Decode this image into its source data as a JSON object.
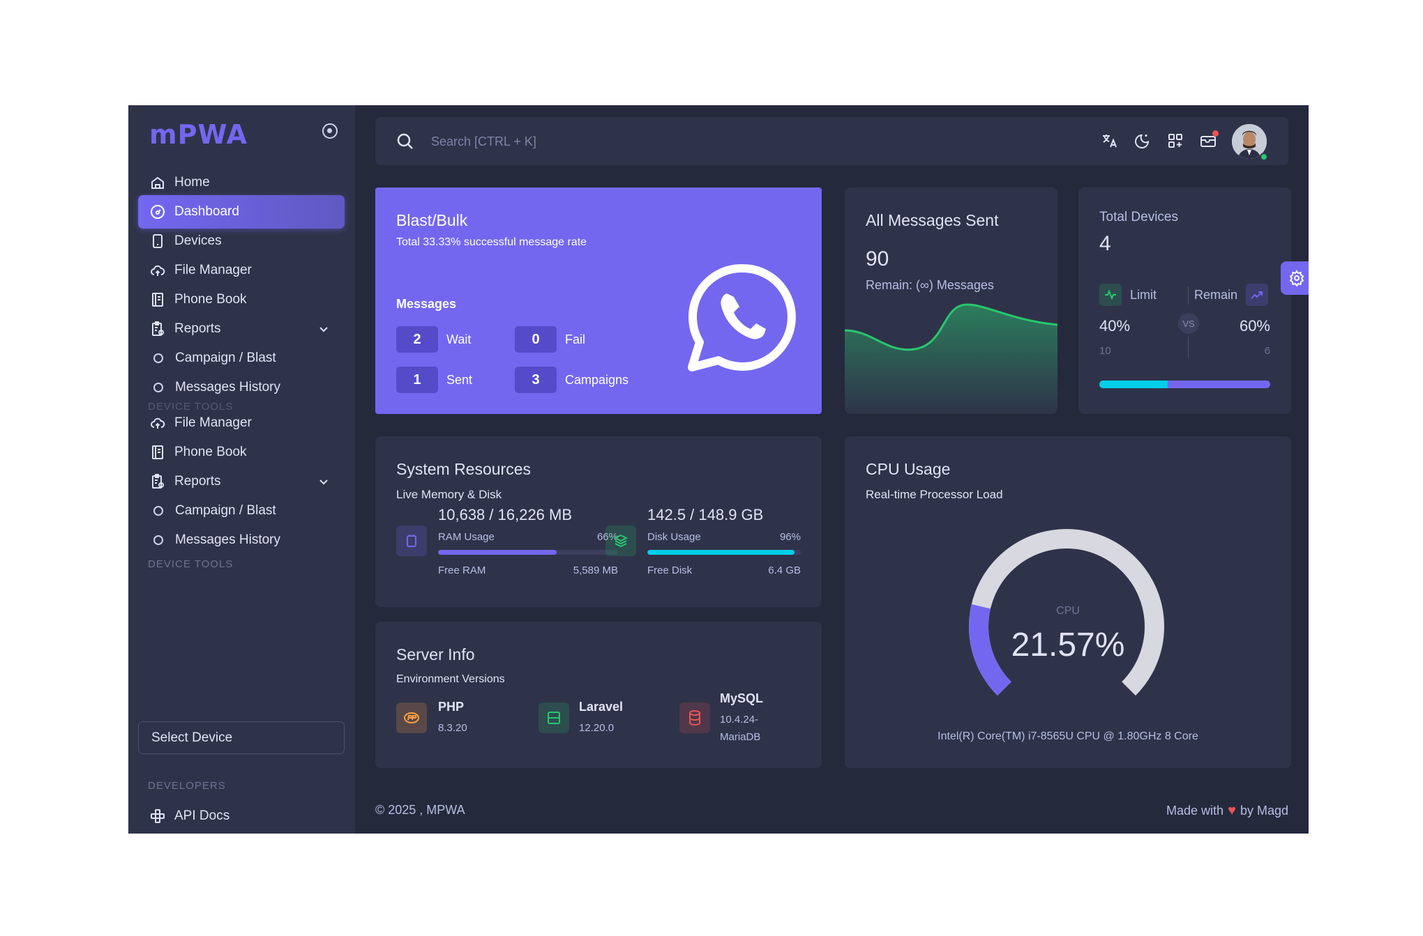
{
  "app": {
    "logo": "mPWA"
  },
  "colors": {
    "primary": "#7367f0",
    "info": "#00cfe8",
    "success": "#28c76f",
    "danger": "#ea5455",
    "bg": "#25293c",
    "card": "#2f3349"
  },
  "sidebar": {
    "items": [
      {
        "label": "Home",
        "icon": "home-icon"
      },
      {
        "label": "Dashboard",
        "icon": "dashboard-icon",
        "active": true
      },
      {
        "label": "Devices",
        "icon": "device-icon"
      },
      {
        "label": "File Manager",
        "icon": "cloud-upload-icon"
      },
      {
        "label": "Phone Book",
        "icon": "phonebook-icon"
      },
      {
        "label": "Reports",
        "icon": "report-icon"
      },
      {
        "label": "Campaign / Blast",
        "icon": "circle-icon"
      },
      {
        "label": "Messages History",
        "icon": "circle-icon"
      },
      {
        "label": "File Manager",
        "icon": "cloud-upload-icon"
      },
      {
        "label": "Phone Book",
        "icon": "phonebook-icon"
      },
      {
        "label": "Reports",
        "icon": "report-icon"
      },
      {
        "label": "Campaign / Blast",
        "icon": "circle-icon"
      },
      {
        "label": "Messages History",
        "icon": "circle-icon"
      },
      {
        "label": "API Docs",
        "icon": "api-icon"
      }
    ],
    "section_device_tools": "DEVICE TOOLS",
    "section_device_tools_ghost": "DEVICE TOOLS",
    "select_device": "Select Device",
    "section_developers": "DEVELOPERS"
  },
  "header": {
    "search_placeholder": "Search [CTRL + K]"
  },
  "blast": {
    "title": "Blast/Bulk",
    "subtitle": "Total 33.33% successful message rate",
    "messages_label": "Messages",
    "stats": [
      {
        "value": "2",
        "label": "Wait"
      },
      {
        "value": "0",
        "label": "Fail"
      },
      {
        "value": "1",
        "label": "Sent"
      },
      {
        "value": "3",
        "label": "Campaigns"
      }
    ]
  },
  "messages_sent": {
    "title": "All Messages Sent",
    "value": "90",
    "remain": "Remain: (∞) Messages"
  },
  "devices": {
    "label": "Total Devices",
    "value": "4",
    "limit_label": "Limit",
    "remain_label": "Remain",
    "limit_pct": "40%",
    "remain_pct": "60%",
    "limit_count": "10",
    "remain_count": "6",
    "vs": "VS",
    "progress_fraction": 0.4
  },
  "resources": {
    "title": "System Resources",
    "subtitle": "Live Memory & Disk",
    "ram": {
      "value": "10,638 / 16,226 MB",
      "label": "RAM Usage",
      "pct": "66%",
      "free_label": "Free RAM",
      "free_value": "5,589 MB",
      "fraction": 0.66
    },
    "disk": {
      "value": "142.5 / 148.9 GB",
      "label": "Disk Usage",
      "pct": "96%",
      "free_label": "Free Disk",
      "free_value": "6.4 GB",
      "fraction": 0.96
    }
  },
  "server": {
    "title": "Server Info",
    "subtitle": "Environment Versions",
    "php": {
      "name": "PHP",
      "version": "8.3.20"
    },
    "laravel": {
      "name": "Laravel",
      "version": "12.20.0"
    },
    "mysql": {
      "name": "MySQL",
      "version_line1": "10.4.24-",
      "version_line2": "MariaDB"
    }
  },
  "cpu": {
    "title": "CPU Usage",
    "subtitle": "Real-time Processor Load",
    "label": "CPU",
    "value": "21.57%",
    "fraction": 0.2157,
    "caption": "Intel(R) Core(TM) i7-8565U CPU @ 1.80GHz 8 Core"
  },
  "footer": {
    "left": "© 2025 , MPWA",
    "made_with": "Made with",
    "by": "by Magd"
  }
}
